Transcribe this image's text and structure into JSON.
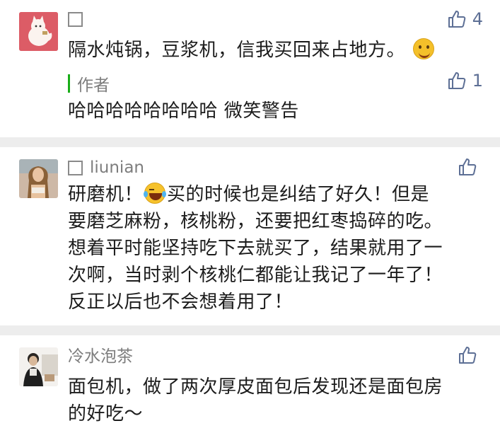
{
  "comments": [
    {
      "name": "",
      "text": "隔水炖锅，豆浆机，信我买回来占地方。",
      "emoji": "smile-emoji",
      "likes": "4",
      "reply": {
        "author_label": "作者",
        "text": "哈哈哈哈哈哈哈哈 微笑警告",
        "likes": "1"
      }
    },
    {
      "name": "liunian",
      "text_before_emoji": "研磨机！",
      "emoji": "laugh-tears-emoji",
      "text_lines": [
        "买的时候也是纠结了好久！但是",
        "要磨芝麻粉，核桃粉，还要把红枣捣碎的吃。",
        "想着平时能坚持吃下去就买了，结果就用了一",
        "次啊，当时剥个核桃仁都能让我记了一年了！",
        "反正以后也不会想着用了！"
      ],
      "likes": ""
    },
    {
      "name": "冷水泡茶",
      "text_lines": [
        "面包机，做了两次厚皮面包后发现还是面包房",
        "的好吃～"
      ],
      "likes": ""
    }
  ],
  "colors": {
    "background": "#ededed",
    "card": "#ffffff",
    "like_blue": "#5d6f95",
    "author_bar": "#1aad19"
  },
  "icons": [
    "thumbs-up-icon",
    "checkbox-icon",
    "smile-emoji",
    "laugh-tears-emoji"
  ]
}
